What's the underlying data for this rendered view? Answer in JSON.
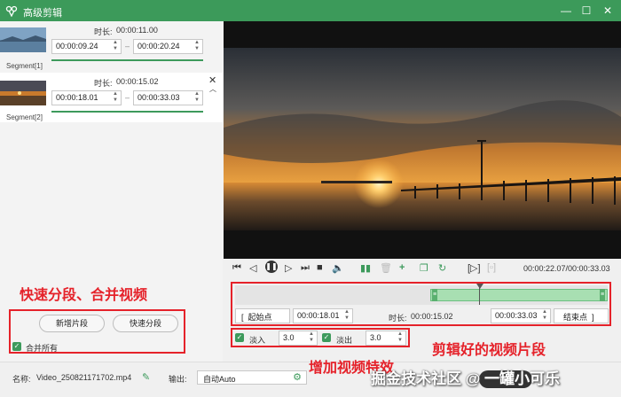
{
  "window": {
    "title": "高级剪辑"
  },
  "segments": [
    {
      "label": "Segment[1]",
      "duration_label": "时长:",
      "duration": "00:00:11.00",
      "start": "00:00:09.24",
      "end": "00:00:20.24"
    },
    {
      "label": "Segment[2]",
      "duration_label": "时长:",
      "duration": "00:00:15.02",
      "start": "00:00:18.01",
      "end": "00:00:33.03"
    }
  ],
  "left_actions": {
    "add_segment": "新增片段",
    "quick_split": "快速分段",
    "merge_all": "合并所有",
    "merge_all_checked": true
  },
  "annotations": {
    "split_merge": "快速分段、合并视频",
    "clip_result": "剪辑好的视频片段",
    "effects": "增加视频特效"
  },
  "player": {
    "time": "00:00:22.07/00:00:33.03"
  },
  "clip_range": {
    "start_btn": "起始点",
    "start": "00:00:18.01",
    "duration_label": "时长:",
    "duration": "00:00:15.02",
    "end": "00:00:33.03",
    "end_btn": "结束点"
  },
  "effects": {
    "fade_in_label": "淡入",
    "fade_in_value": "3.0",
    "fade_out_label": "淡出",
    "fade_out_value": "3.0"
  },
  "bottom": {
    "name_label": "名称:",
    "name_value": "Video_250821171702.mp4",
    "output_label": "输出:",
    "output_value": "自动Auto"
  },
  "watermark": "掘金技术社区 @ 一罐小可乐",
  "colors": {
    "accent": "#3d9a5c",
    "annotation": "#e5222a"
  }
}
